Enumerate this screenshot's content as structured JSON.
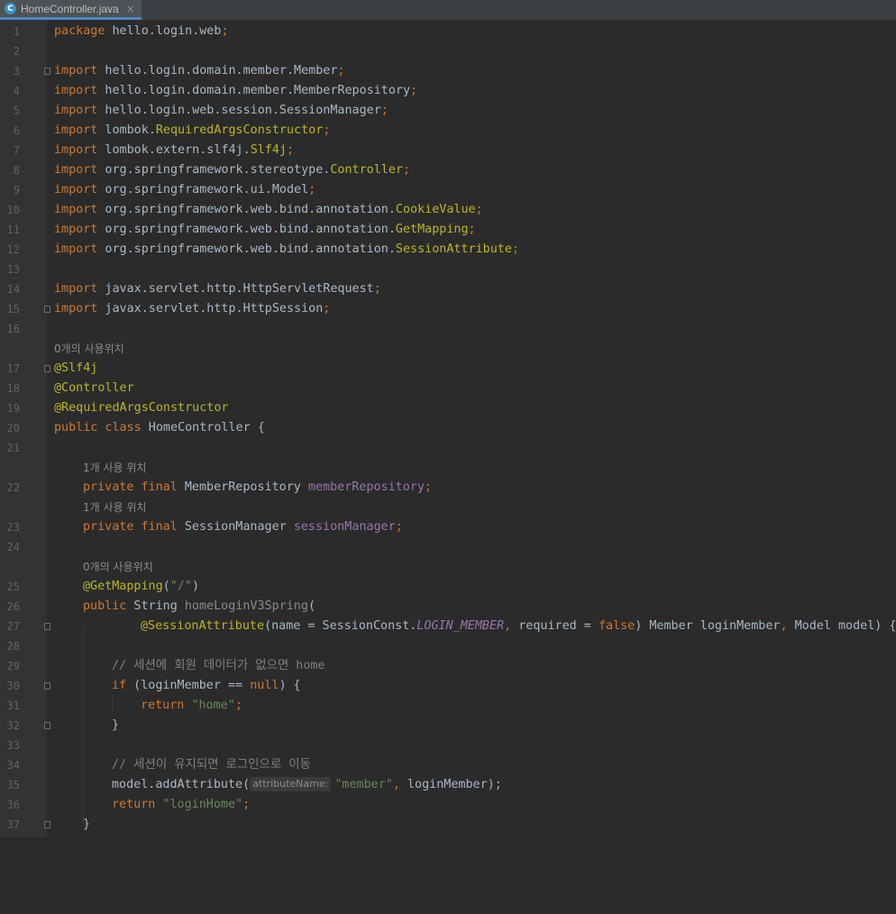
{
  "tab": {
    "title": "HomeController.java",
    "icon": "C",
    "close": "×"
  },
  "hints": {
    "unused": "0개의 사용위치",
    "one": "1개 사용 위치",
    "param": "attributeName:"
  },
  "lines": {
    "l1": {
      "num": "1",
      "pkg_kw": "package",
      "pkg": " hello.login.web",
      "semi": ";"
    },
    "l2": {
      "num": "2"
    },
    "l3": {
      "num": "3",
      "kw": "import",
      "path": " hello.login.domain.member.Member",
      "semi": ";"
    },
    "l4": {
      "num": "4",
      "kw": "import",
      "path": " hello.login.domain.member.MemberRepository",
      "semi": ";"
    },
    "l5": {
      "num": "5",
      "kw": "import",
      "path": " hello.login.web.session.SessionManager",
      "semi": ";"
    },
    "l6": {
      "num": "6",
      "kw": "import",
      "path": " lombok.",
      "ann": "RequiredArgsConstructor",
      "semi": ";"
    },
    "l7": {
      "num": "7",
      "kw": "import",
      "path": " lombok.extern.slf4j.",
      "ann": "Slf4j",
      "semi": ";"
    },
    "l8": {
      "num": "8",
      "kw": "import",
      "path": " org.springframework.stereotype.",
      "ann": "Controller",
      "semi": ";"
    },
    "l9": {
      "num": "9",
      "kw": "import",
      "path": " org.springframework.ui.Model",
      "semi": ";"
    },
    "l10": {
      "num": "10",
      "kw": "import",
      "path": " org.springframework.web.bind.annotation.",
      "ann": "CookieValue",
      "semi": ";"
    },
    "l11": {
      "num": "11",
      "kw": "import",
      "path": " org.springframework.web.bind.annotation.",
      "ann": "GetMapping",
      "semi": ";"
    },
    "l12": {
      "num": "12",
      "kw": "import",
      "path": " org.springframework.web.bind.annotation.",
      "ann": "SessionAttribute",
      "semi": ";"
    },
    "l13": {
      "num": "13"
    },
    "l14": {
      "num": "14",
      "kw": "import",
      "path": " javax.servlet.http.HttpServletRequest",
      "semi": ";"
    },
    "l15": {
      "num": "15",
      "kw": "import",
      "path": " javax.servlet.http.HttpSession",
      "semi": ";"
    },
    "l16": {
      "num": "16"
    },
    "l17": {
      "num": "17",
      "ann": "@Slf4j"
    },
    "l18": {
      "num": "18",
      "ann": "@Controller"
    },
    "l19": {
      "num": "19",
      "ann": "@RequiredArgsConstructor"
    },
    "l20": {
      "num": "20",
      "kw": "public class",
      "name": " HomeController {"
    },
    "l21": {
      "num": "21"
    },
    "l22": {
      "num": "22",
      "kw": "private final",
      "type": " MemberRepository ",
      "field": "memberRepository",
      "semi": ";"
    },
    "l23": {
      "num": "23",
      "kw": "private final",
      "type": " SessionManager ",
      "field": "sessionManager",
      "semi": ";"
    },
    "l24": {
      "num": "24"
    },
    "l25": {
      "num": "25",
      "ann": "@GetMapping",
      "open": "(",
      "str": "\"/\"",
      "close": ")"
    },
    "l26": {
      "num": "26",
      "kw": "public",
      "type": " String ",
      "method": "homeLoginV3Spring",
      "open": "("
    },
    "l27": {
      "num": "27",
      "ann": "@SessionAttribute",
      "a": "(name = SessionConst.",
      "const": "LOGIN_MEMBER",
      "comma1": ", ",
      "b": "required = ",
      "kwfalse": "false",
      "c": ") Member loginMember",
      "comma2": ", ",
      "d": "Model model) {"
    },
    "l28": {
      "num": "28"
    },
    "l29": {
      "num": "29",
      "comment": "// 세션에 회원 데이터가 없으면 home"
    },
    "l30": {
      "num": "30",
      "kw": "if",
      "a": " (loginMember == ",
      "kwnull": "null",
      "b": ") {"
    },
    "l31": {
      "num": "31",
      "kw": "return ",
      "str": "\"home\"",
      "semi": ";"
    },
    "l32": {
      "num": "32",
      "brace": "}"
    },
    "l33": {
      "num": "33"
    },
    "l34": {
      "num": "34",
      "comment": "// 세션이 유지되면 로그인으로 이동"
    },
    "l35": {
      "num": "35",
      "a": "model.addAttribute(",
      "str": "\"member\"",
      "comma": ", ",
      "b": "loginMember);"
    },
    "l36": {
      "num": "36",
      "kw": "return ",
      "str": "\"loginHome\"",
      "semi": ";"
    },
    "l37": {
      "num": "37",
      "brace": "}"
    }
  }
}
